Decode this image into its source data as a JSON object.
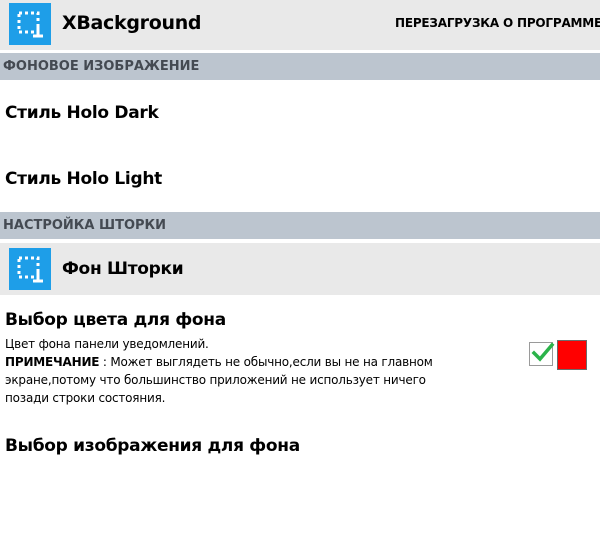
{
  "app_bar": {
    "title": "XBackground",
    "icon": "crop-icon",
    "actions": [
      {
        "label": "ПЕРЕЗАГРУЗКА"
      },
      {
        "label": "О ПРОГРАММЕ"
      }
    ]
  },
  "sections": {
    "background_image": {
      "header": "ФОНОВОЕ ИЗОБРАЖЕНИЕ",
      "items": [
        {
          "title": "Стиль Holo Dark"
        },
        {
          "title": "Стиль Holo Light"
        }
      ]
    },
    "shade": {
      "header": "НАСТРОЙКА ШТОРКИ",
      "subheader": {
        "title": "Фон Шторки",
        "icon": "crop-icon"
      },
      "color_pref": {
        "title": "Выбор цвета для фона",
        "summary_line1": "Цвет фона панели уведомлений.",
        "note_label": "ПРИМЕЧАНИЕ",
        "note_line1": " : Может выглядеть не обычно,если вы не на главном",
        "note_line2": "экране,потому что большинство приложений не использует ничего",
        "note_line3": "позади строки состояния.",
        "checked": true,
        "swatch_color": "#ff0000"
      },
      "image_pref": {
        "title": "Выбор изображения для фона"
      }
    }
  },
  "colors": {
    "accent": "#1e9ee8",
    "app_bar_bg": "#e9e9e9",
    "section_header_bg": "#bcc5cf",
    "checkmark": "#2bb34a"
  }
}
